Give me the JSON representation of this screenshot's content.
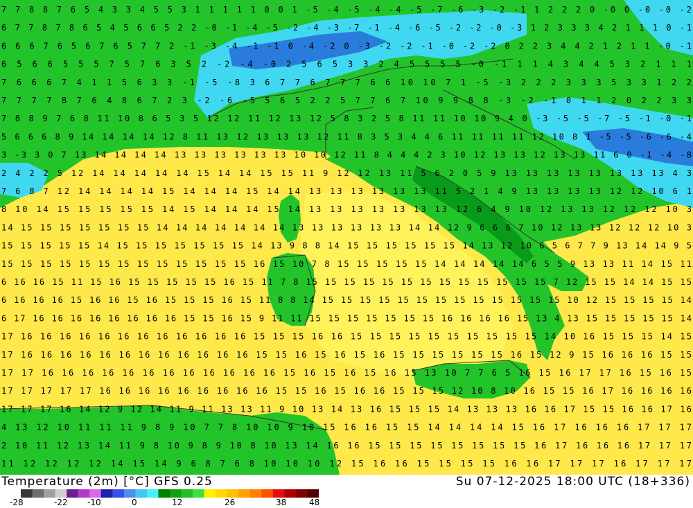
{
  "header": {
    "variable": "Temperature (2m) [°C] GFS 0.25",
    "valid_time": "Su 07-12-2025 18:00 UTC (18+336)"
  },
  "legend": {
    "tick_labels": [
      "-28",
      "-22",
      "-10",
      "0",
      "12",
      "26",
      "38",
      "48"
    ],
    "colors": [
      "#3a3a3a",
      "#6e6e6e",
      "#a0a0a0",
      "#cfcfcf",
      "#6b1f8f",
      "#b03ac8",
      "#e066e8",
      "#2020b0",
      "#3a4ee8",
      "#4c8cf0",
      "#40c8f0",
      "#48f0f8",
      "#008000",
      "#10a010",
      "#20c020",
      "#40e040",
      "#fff000",
      "#ffd800",
      "#ffc000",
      "#ffa000",
      "#ff8000",
      "#ff5000",
      "#e01010",
      "#b00000",
      "#800000",
      "#500000"
    ]
  },
  "map": {
    "region": "Italy and central Mediterranean",
    "colors": {
      "sea_warm": "#ffe84a",
      "sea_mild": "#fff25a",
      "land_green": "#22c42a",
      "land_dark": "#0a9a1a",
      "cold_cyan": "#40d8f0",
      "cold_blue": "#2a7cdc",
      "border": "#333333"
    },
    "rows": [
      "7 7 8 8 7 6 5 4 3 3 4 5 5 3 1 1 1 1 1 0 0 1 -5 -4 -5 -4 -4 -5 -7 -6 -3 -2 -1 1 2 2 2 0 -0 0 -0 -0 -2",
      "6 7 7 8 7 8 6 5 4 5 6 6 5 2 2 -0 -1 -4 -5 -2 -4 -3 -7 -1 -4 -6 -5 -2 -2 -0 -3 1 2 3 3 3 4 2 1 1 1 0 -1",
      "6 6 6 7 6 5 6 7 6 5 7 7 2 -1 -3 -4 -1 -1 0 -4 -2 0 -3 -2 -2 -1 -0 -2 -2 0 2 2 3 4 4 2 1 2 1 1 -0 -1",
      "6 5 6 6 5 5 5 7 5 7 6 3 5 2 -2 -4 -0 2 5 6 5 3 3 2 4 5 5 5 5 -0 -1 1 1 4 3 4 4 5 3 2 1 1 1",
      "7 6 6 6 7 4 1 1 5 6 3 3 -1 -5 -8 3 6 7 7 6 7 7 7 6 6 10 10 7 1 -5 -3 2 2 2 3 3 3 5 3 3 1 2 2",
      "7 7 7 7 8 7 6 4 8 6 7 2 3 -2 -6 -5 5 6 5 2 2 5 7 7 6 7 10 9 9 8 8 -3 -2 -1 0 1 1 2 0 2 2 3 3",
      "7 8 8 9 7 6 8 11 10 8 6 5 3 5 12 12 11 12 13 12 5 8 3 2 5 8 11 11 10 10 9 4 0 -3 -5 -5 -7 -5 -1 -0 -1",
      "5 6 6 6 8 9 14 14 14 14 12 8 11 13 12 13 13 13 12 11 8 3 5 3 4 4 6 11 11 11 11 12 10 8 1 -5 -5 -6 -6 -4",
      "3 -3 3 0 7 13 14 14 14 14 13 13 13 13 13 13 10 10 12 11 8 4 4 4 2 3 10 12 13 13 12 13 13 11 6 0 -1 -4 -8",
      "2 4 2 2 5 12 14 14 14 14 14 15 14 14 15 15 11 9 12 12 13 11 5 6 2 0 5 9 13 13 13 13 13 13 13 13 4 3",
      "7 6 8 7 12 14 14 14 14 15 14 14 14 15 14 14 13 13 13 13 13 13 11 5 2 1 4 9 13 13 13 13 12 12 10 6 1",
      "8 10 14 15 15 15 15 15 14 15 14 14 14 15 14 13 13 13 13 13 13 13 12 6 4 9 10 12 13 13 12 12 12 10 3",
      "14 15 15 15 15 15 15 15 14 14 14 14 14 14 14 13 13 13 13 13 13 14 14 12 9 6 6 6 7 10 12 13 13 12 12 12 10 3",
      "15 15 15 15 15 14 15 15 15 15 15 15 15 14 13 9 8 8 14 15 15 15 15 15 15 14 13 12 10 6 5 6 7 7 9 13 14 14 9 5",
      "15 15 15 15 15 15 15 15 15 15 15 15 15 16 15 10 7 8 15 15 15 15 15 14 14 14 14 14 6 5 5 9 13 13 11 14 15 11",
      "6 16 16 15 11 15 16 15 15 15 15 15 16 15 11 7 8 15 15 15 15 15 15 15 15 15 15 15 15 15 7 12 15 15 14 14 15 15",
      "6 16 16 16 15 16 16 15 16 15 15 15 16 15 11 8 8 14 15 15 15 15 15 15 15 15 15 15 15 15 15 10 12 15 15 15 15 14",
      "6 17 16 16 16 16 16 16 16 16 15 15 16 15 9 11 11 15 15 15 15 15 15 15 16 16 16 16 15 13 4 13 15 15 15 15 15 14",
      "17 16 16 16 16 16 16 16 16 16 16 16 16 15 15 15 16 16 15 15 15 15 15 15 15 15 15 15 14 10 16 15 15 15 14 15",
      "17 16 16 16 16 16 16 16 16 16 16 16 16 15 15 16 15 16 15 16 15 15 15 15 15 15 16 15 12 9 15 16 16 16 15 15",
      "17 17 16 16 16 16 16 16 16 16 16 16 16 16 15 16 15 16 15 16 15 13 10 7 7 6 5 16 15 16 17 17 16 15 16 15",
      "17 17 17 17 17 16 16 16 16 16 16 16 16 16 15 15 16 15 16 16 15 15 15 12 10 8 10 16 15 15 16 17 16 16 16 16",
      "17 17 17 16 14 12 9 12 14 11 9 11 13 13 11 9 10 13 14 13 16 15 15 15 14 13 13 13 16 16 17 15 15 16 16 17 16",
      "4 13 12 10 11 11 11 9 8 9 10 7 7 8 10 10 9 10 15 16 16 15 15 14 14 14 14 15 16 17 16 16 16 17 17 17",
      "2 10 11 12 13 14 11 9 8 10 9 8 9 10 8 10 13 14 16 16 15 15 15 15 15 15 15 15 16 17 16 16 16 17 17 17",
      "11 12 12 12 12 14 15 14 9 6 8 7 6 8 10 10 10 12 15 16 16 15 15 15 15 16 16 17 17 17 16 17 17 17"
    ]
  }
}
